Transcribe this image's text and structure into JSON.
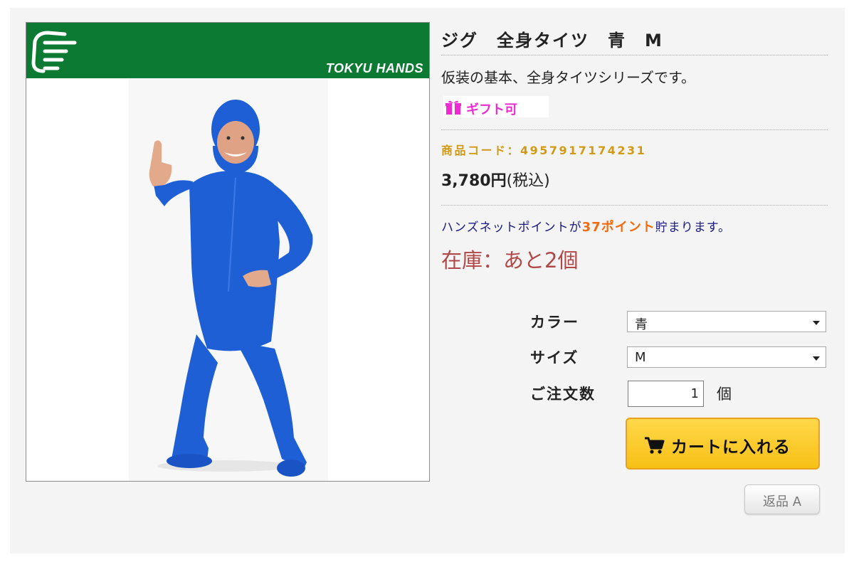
{
  "image": {
    "brand": "TOKYU HANDS",
    "logo_icon": "pointing-hand-logo",
    "banner_color": "#0d7a33",
    "suit_color": "#1f5fd6"
  },
  "product": {
    "title": "ジグ　全身タイツ　青　M",
    "description": "仮装の基本、全身タイツシリーズです。",
    "gift_label": "ギフト可",
    "gift_icon": "gift-icon",
    "code": "商品コード：4957917174231",
    "price": "3,780円",
    "tax_note": "(税込)",
    "points_prefix": "ハンズネットポイントが",
    "points_value": "37ポイント",
    "points_suffix": "貯まります。",
    "stock": "在庫：あと2個"
  },
  "options": {
    "color_label": "カラー",
    "color_value": "青",
    "size_label": "サイズ",
    "size_value": "M",
    "quantity_label": "ご注文数",
    "quantity_value": "1",
    "quantity_unit": "個"
  },
  "actions": {
    "cart_label": "カートに入れる",
    "cart_icon": "cart-icon",
    "return_label": "返品 A"
  },
  "colors": {
    "accent_code": "#d19a16",
    "points_orange": "#f26b0f",
    "stock_red": "#b04848",
    "gift_pink": "#ee2bd0",
    "button_yellow": "#f7c015"
  }
}
